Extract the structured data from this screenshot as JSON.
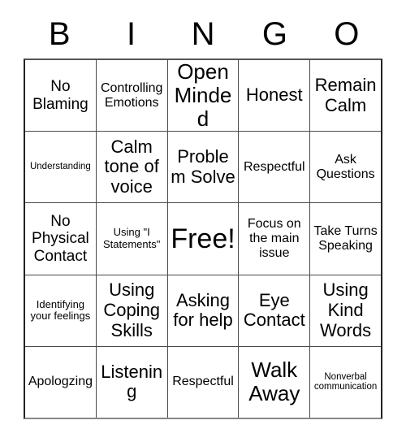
{
  "header": {
    "letters": [
      "B",
      "I",
      "N",
      "G",
      "O"
    ]
  },
  "grid": {
    "rows": [
      [
        {
          "text": "No Blaming",
          "size": "lg"
        },
        {
          "text": "Controlling Emotions",
          "size": "md"
        },
        {
          "text": "Open Minded",
          "size": "xxl"
        },
        {
          "text": "Honest",
          "size": "xl"
        },
        {
          "text": "Remain Calm",
          "size": "xl"
        }
      ],
      [
        {
          "text": "Understanding",
          "size": "xs"
        },
        {
          "text": "Calm tone of voice",
          "size": "xl"
        },
        {
          "text": "Problem Solve",
          "size": "xl"
        },
        {
          "text": "Respectful",
          "size": "md"
        },
        {
          "text": "Ask Questions",
          "size": "md"
        }
      ],
      [
        {
          "text": "No Physical Contact",
          "size": "lg"
        },
        {
          "text": "Using \"I Statements\"",
          "size": "sm"
        },
        {
          "text": "Free!",
          "size": "free"
        },
        {
          "text": "Focus on the main issue",
          "size": "md"
        },
        {
          "text": "Take Turns Speaking",
          "size": "md"
        }
      ],
      [
        {
          "text": "Identifying your feelings",
          "size": "sm"
        },
        {
          "text": "Using Coping Skills",
          "size": "xl"
        },
        {
          "text": "Asking for help",
          "size": "xl"
        },
        {
          "text": "Eye Contact",
          "size": "xl"
        },
        {
          "text": "Using Kind Words",
          "size": "xl"
        }
      ],
      [
        {
          "text": "Apologzing",
          "size": "md"
        },
        {
          "text": "Listening",
          "size": "xl"
        },
        {
          "text": "Respectful",
          "size": "md"
        },
        {
          "text": "Walk Away",
          "size": "xxl"
        },
        {
          "text": "Nonverbal communication",
          "size": "xs"
        }
      ]
    ]
  },
  "colors": {
    "background": "#ffffff",
    "text": "#000000",
    "grid_line": "#4a4a4a",
    "outer_border": "#222222"
  }
}
